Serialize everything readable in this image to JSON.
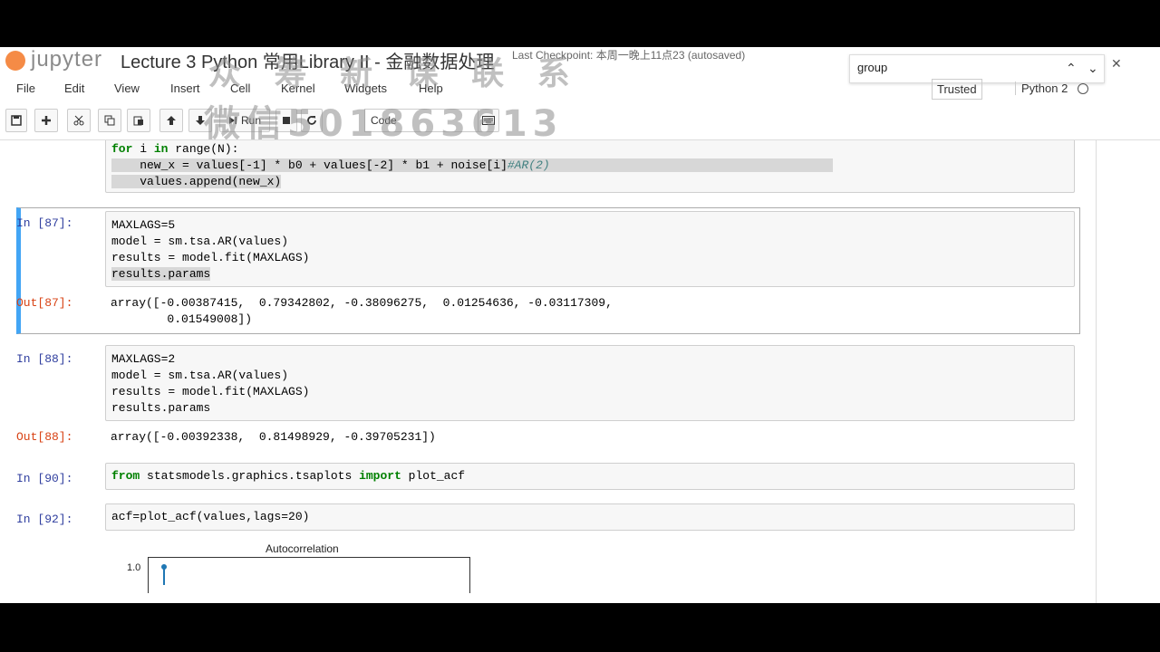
{
  "header": {
    "logo": "jupyter",
    "notebook_title": "Lecture 3 Python 常用Library II - 金融数据处理",
    "checkpoint": "Last Checkpoint: 本周一晚上11点23  (autosaved)",
    "watermark_line1": "众 筹 新 课 联 系",
    "watermark_line2": "微信501863613"
  },
  "find": {
    "value": "group",
    "up": "⌃",
    "down": "⌄",
    "close": "✕"
  },
  "menu": [
    "File",
    "Edit",
    "View",
    "Insert",
    "Cell",
    "Kernel",
    "Widgets",
    "Help"
  ],
  "trusted": "Trusted",
  "kernel": "Python 2",
  "toolbar": {
    "run_label": "Run",
    "cell_type": "Code"
  },
  "cells": [
    {
      "type": "code-fragment",
      "lines": [
        "for i in range(N):",
        "    new_x = values[-1] * b0 + values[-2] * b1 + noise[i]#AR(2)",
        "    values.append(new_x)"
      ]
    },
    {
      "prompt_in": "In [87]:",
      "lines": [
        "MAXLAGS=5",
        "model = sm.tsa.AR(values)",
        "results = model.fit(MAXLAGS)",
        "results.params"
      ],
      "prompt_out": "Out[87]:",
      "output": [
        "array([-0.00387415,  0.79342802, -0.38096275,  0.01254636, -0.03117309,",
        "        0.01549008])"
      ]
    },
    {
      "prompt_in": "In [88]:",
      "lines": [
        "MAXLAGS=2",
        "model = sm.tsa.AR(values)",
        "results = model.fit(MAXLAGS)",
        "results.params"
      ],
      "prompt_out": "Out[88]:",
      "output": [
        "array([-0.00392338,  0.81498929, -0.39705231])"
      ]
    },
    {
      "prompt_in": "In [90]:",
      "lines": [
        "from statsmodels.graphics.tsaplots import plot_acf"
      ]
    },
    {
      "prompt_in": "In [92]:",
      "lines": [
        "acf=plot_acf(values,lags=20)"
      ]
    }
  ],
  "plot": {
    "title": "Autocorrelation",
    "ytick_top": "1.0"
  }
}
